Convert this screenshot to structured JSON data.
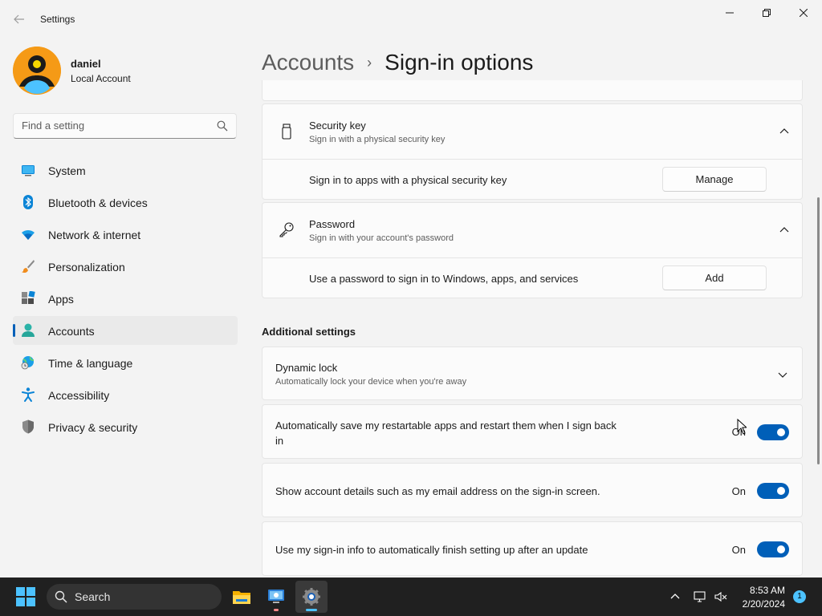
{
  "window": {
    "title": "Settings",
    "back_icon": "back-arrow-icon",
    "controls": [
      "minimize-icon",
      "restore-icon",
      "close-icon"
    ]
  },
  "profile": {
    "name": "daniel",
    "account_type": "Local Account",
    "avatar_color": "#f59a16"
  },
  "search": {
    "placeholder": "Find a setting",
    "icon": "search-icon"
  },
  "sidebar": {
    "items": [
      {
        "label": "System",
        "icon": "system-icon",
        "active": false
      },
      {
        "label": "Bluetooth & devices",
        "icon": "bluetooth-icon",
        "active": false
      },
      {
        "label": "Network & internet",
        "icon": "wifi-icon",
        "active": false
      },
      {
        "label": "Personalization",
        "icon": "brush-icon",
        "active": false
      },
      {
        "label": "Apps",
        "icon": "apps-icon",
        "active": false
      },
      {
        "label": "Accounts",
        "icon": "accounts-icon",
        "active": true
      },
      {
        "label": "Time & language",
        "icon": "globe-clock-icon",
        "active": false
      },
      {
        "label": "Accessibility",
        "icon": "accessibility-icon",
        "active": false
      },
      {
        "label": "Privacy & security",
        "icon": "shield-icon",
        "active": false
      }
    ]
  },
  "header": {
    "parent": "Accounts",
    "separator": "›",
    "current": "Sign-in options"
  },
  "security_key": {
    "title": "Security key",
    "subtitle": "Sign in with a physical security key",
    "icon": "usb-key-icon",
    "expanded": true,
    "detail_text": "Sign in to apps with a physical security key",
    "button_label": "Manage"
  },
  "password": {
    "title": "Password",
    "subtitle": "Sign in with your account's password",
    "icon": "key-icon",
    "expanded": true,
    "detail_text": "Use a password to sign in to Windows, apps, and services",
    "button_label": "Add"
  },
  "additional": {
    "heading": "Additional settings",
    "dynamic_lock": {
      "title": "Dynamic lock",
      "subtitle": "Automatically lock your device when you're away",
      "expanded": false
    },
    "toggles": [
      {
        "label_line1": "Automatically save my restartable apps and restart them when I sign back",
        "label_line2": "in",
        "state": "On",
        "on": true
      },
      {
        "label_line1": "Show account details such as my email address on the sign-in screen.",
        "label_line2": "",
        "state": "On",
        "on": true
      },
      {
        "label_line1": "Use my sign-in info to automatically finish setting up after an update",
        "label_line2": "",
        "state": "On",
        "on": true
      }
    ]
  },
  "taskbar": {
    "search_label": "Search",
    "apps": [
      "file-explorer-icon",
      "remote-desktop-icon",
      "settings-gear-icon"
    ],
    "tray": [
      "chevron-up-icon",
      "network-icon",
      "volume-muted-icon"
    ],
    "time": "8:53 AM",
    "date": "2/20/2024",
    "notification_count": "1",
    "accent": "#4cc2ff"
  },
  "colors": {
    "accent": "#005fb8",
    "background": "#f3f3f3",
    "card": "#fbfbfb"
  }
}
